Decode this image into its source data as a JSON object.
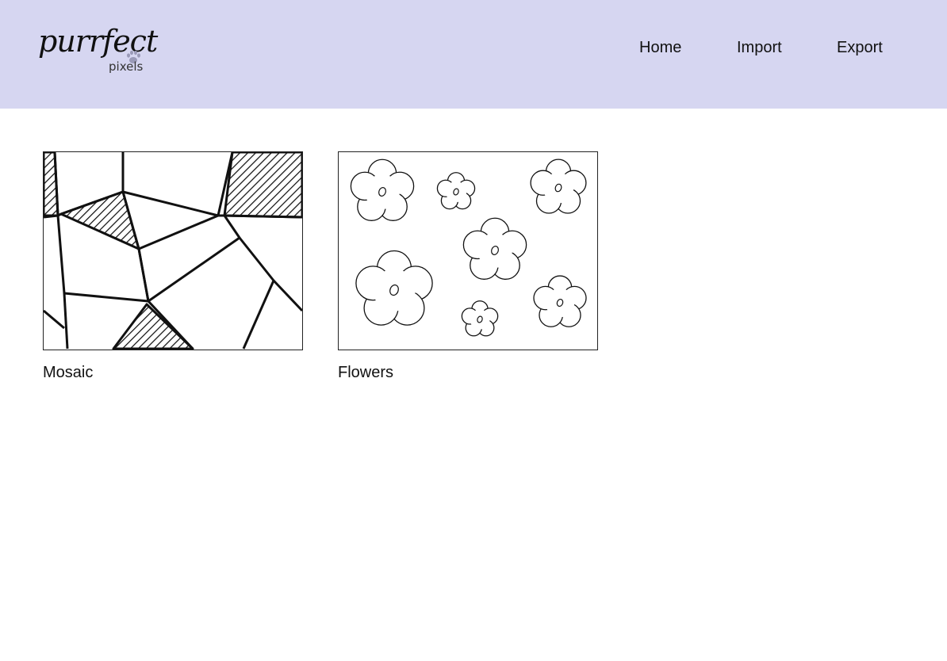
{
  "header": {
    "logo": {
      "script_text": "purrfect",
      "sub_text": "pixels",
      "icon": "paw-icon"
    },
    "nav": [
      {
        "label": "Home"
      },
      {
        "label": "Import"
      },
      {
        "label": "Export"
      }
    ],
    "background_color": "#d6d6f1"
  },
  "gallery": {
    "items": [
      {
        "label": "Mosaic",
        "thumbnail": "mosaic-line-art"
      },
      {
        "label": "Flowers",
        "thumbnail": "flowers-line-art"
      }
    ]
  }
}
